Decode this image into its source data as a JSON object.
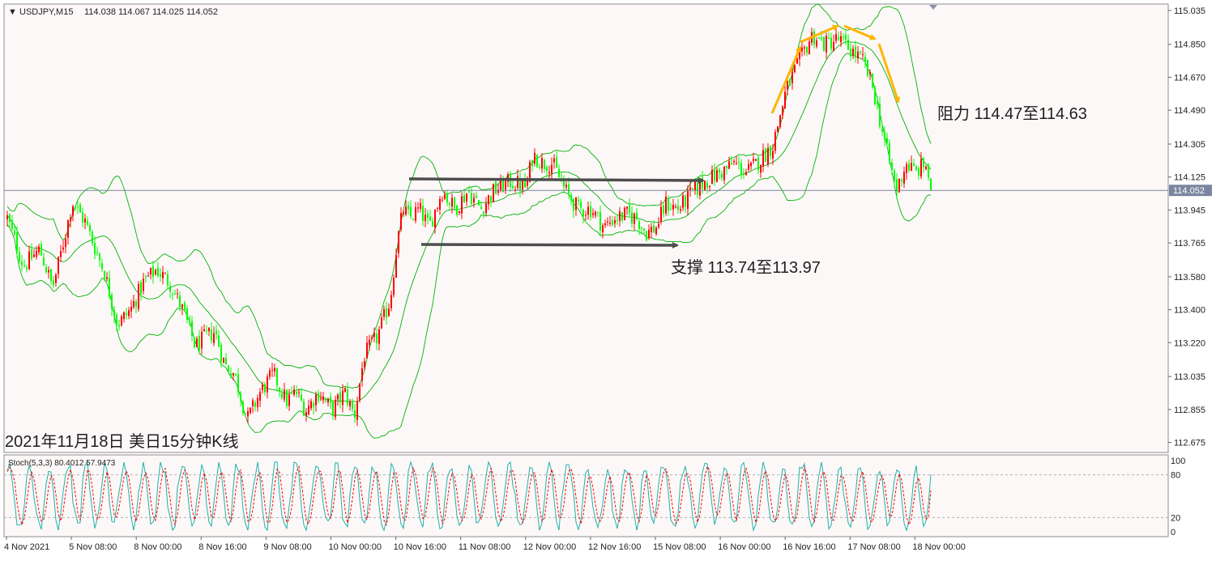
{
  "header": {
    "symbol_label": "USDJPY,M15",
    "ohlc_label": "114.038 114.067 114.025 114.052"
  },
  "annotations": {
    "resistance": "阻力 114.47至114.63",
    "support": "支撑 113.74至113.97",
    "caption": "2021年11月18日 美日15分钟K线"
  },
  "oscillator": {
    "label": "Stoch(5,3,3) 80.4012 57.9473",
    "k": 80.4012,
    "d": 57.9473,
    "levels": [
      20,
      80
    ],
    "scale_labels": [
      "100",
      "80",
      "20",
      "0"
    ]
  },
  "colors": {
    "bull_candle": "#ff0000",
    "bear_candle": "#00ff00",
    "bands": "#00b400",
    "price_line": "#7a86a0",
    "arrows": "#4d4d4d",
    "pattern_arrows": "#ffb400",
    "stoch_main": "#20b2aa",
    "stoch_signal": "#ff0000"
  },
  "chart_data": [
    {
      "type": "candlestick",
      "symbol": "USDJPY",
      "timeframe": "M15",
      "current_price": 114.052,
      "current_price_label": "114.052",
      "ylim": [
        112.62,
        115.07
      ],
      "y_ticks": [
        "115.035",
        "114.850",
        "114.670",
        "114.490",
        "114.305",
        "114.125",
        "113.945",
        "113.765",
        "113.580",
        "113.400",
        "113.220",
        "113.035",
        "112.855",
        "112.675"
      ],
      "x_ticks": [
        "4 Nov 2021",
        "5 Nov 08:00",
        "8 Nov 00:00",
        "8 Nov 16:00",
        "9 Nov 08:00",
        "10 Nov 00:00",
        "10 Nov 16:00",
        "11 Nov 08:00",
        "12 Nov 00:00",
        "12 Nov 16:00",
        "15 Nov 08:00",
        "16 Nov 00:00",
        "16 Nov 16:00",
        "17 Nov 08:00",
        "18 Nov 00:00"
      ],
      "indicator": "Bollinger Bands",
      "resistance_zone": [
        114.47,
        114.63
      ],
      "support_zone": [
        113.74,
        113.97
      ],
      "close_path": [
        [
          0,
          113.9
        ],
        [
          0.25,
          113.64
        ],
        [
          0.5,
          113.73
        ],
        [
          0.7,
          113.52
        ],
        [
          0.9,
          113.82
        ],
        [
          1.0,
          113.99
        ],
        [
          1.2,
          113.88
        ],
        [
          1.5,
          113.6
        ],
        [
          1.7,
          113.32
        ],
        [
          1.9,
          113.4
        ],
        [
          2.1,
          113.55
        ],
        [
          2.3,
          113.62
        ],
        [
          2.5,
          113.55
        ],
        [
          2.7,
          113.4
        ],
        [
          2.9,
          113.2
        ],
        [
          3.05,
          113.25
        ],
        [
          3.2,
          113.28
        ],
        [
          3.35,
          113.1
        ],
        [
          3.5,
          113.05
        ],
        [
          3.7,
          112.8
        ],
        [
          3.9,
          112.95
        ],
        [
          4.1,
          113.05
        ],
        [
          4.3,
          112.9
        ],
        [
          4.45,
          112.95
        ],
        [
          4.6,
          112.85
        ],
        [
          4.8,
          112.95
        ],
        [
          5.0,
          112.85
        ],
        [
          5.2,
          112.95
        ],
        [
          5.35,
          112.82
        ],
        [
          5.5,
          113.15
        ],
        [
          5.7,
          113.25
        ],
        [
          5.9,
          113.45
        ],
        [
          6.0,
          113.75
        ],
        [
          6.1,
          113.95
        ],
        [
          6.2,
          113.9
        ],
        [
          6.35,
          113.95
        ],
        [
          6.5,
          113.85
        ],
        [
          6.7,
          114.05
        ],
        [
          6.9,
          113.95
        ],
        [
          7.1,
          114.05
        ],
        [
          7.3,
          113.95
        ],
        [
          7.5,
          114.05
        ],
        [
          7.75,
          114.1
        ],
        [
          8.0,
          114.07
        ],
        [
          8.1,
          114.25
        ],
        [
          8.25,
          114.2
        ],
        [
          8.4,
          114.2
        ],
        [
          8.6,
          114.05
        ],
        [
          8.8,
          113.95
        ],
        [
          9.0,
          113.95
        ],
        [
          9.2,
          113.85
        ],
        [
          9.35,
          113.9
        ],
        [
          9.55,
          113.92
        ],
        [
          9.7,
          113.9
        ],
        [
          9.85,
          113.82
        ],
        [
          10.0,
          113.85
        ],
        [
          10.15,
          113.98
        ],
        [
          10.35,
          113.95
        ],
        [
          10.5,
          114.02
        ],
        [
          10.75,
          114.1
        ],
        [
          11.0,
          114.15
        ],
        [
          11.2,
          114.2
        ],
        [
          11.4,
          114.15
        ],
        [
          11.55,
          114.2
        ],
        [
          11.8,
          114.3
        ],
        [
          12.0,
          114.6
        ],
        [
          12.2,
          114.75
        ],
        [
          12.4,
          114.9
        ],
        [
          12.6,
          114.85
        ],
        [
          12.8,
          114.88
        ],
        [
          13.0,
          114.82
        ],
        [
          13.2,
          114.75
        ],
        [
          13.35,
          114.6
        ],
        [
          13.5,
          114.35
        ],
        [
          13.7,
          114.05
        ],
        [
          13.85,
          114.2
        ],
        [
          14.0,
          114.15
        ],
        [
          14.15,
          114.2
        ],
        [
          14.25,
          114.05
        ],
        [
          14.35,
          114.05
        ]
      ]
    },
    {
      "type": "line",
      "name": "Stoch(5,3,3)",
      "ylim": [
        0,
        100
      ],
      "levels": [
        20,
        80
      ],
      "last_main": 80.4012,
      "last_signal": 57.9473
    }
  ]
}
